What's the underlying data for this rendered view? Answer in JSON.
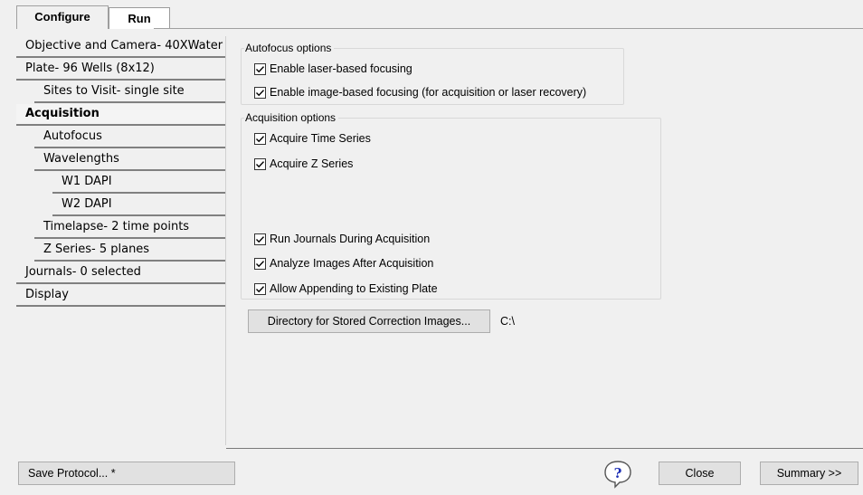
{
  "tabs": [
    {
      "label": "Configure",
      "active": true
    },
    {
      "label": "Run",
      "active": false
    }
  ],
  "nav": {
    "items": [
      {
        "label": "Objective and Camera- 40XWater",
        "level": 0,
        "selected": false
      },
      {
        "label": "Plate- 96 Wells (8x12)",
        "level": 0,
        "selected": false
      },
      {
        "label": "Sites to Visit- single site",
        "level": 1,
        "selected": false
      },
      {
        "label": "Acquisition",
        "level": 0,
        "selected": true
      },
      {
        "label": "Autofocus",
        "level": 1,
        "selected": false
      },
      {
        "label": "Wavelengths",
        "level": 1,
        "selected": false
      },
      {
        "label": "W1 DAPI",
        "level": 2,
        "selected": false
      },
      {
        "label": "W2 DAPI",
        "level": 2,
        "selected": false
      },
      {
        "label": "Timelapse- 2 time points",
        "level": 1,
        "selected": false
      },
      {
        "label": "Z Series- 5 planes",
        "level": 1,
        "selected": false
      },
      {
        "label": "Journals- 0 selected",
        "level": 0,
        "selected": false
      },
      {
        "label": "Display",
        "level": 0,
        "selected": false
      }
    ]
  },
  "autofocus_options": {
    "title": "Autofocus options",
    "options": [
      {
        "label": "Enable laser-based focusing",
        "checked": true
      },
      {
        "label": "Enable image-based focusing (for acquisition or laser recovery)",
        "checked": true
      }
    ]
  },
  "acquisition_options": {
    "title": "Acquisition options",
    "options": [
      {
        "label": "Acquire Time Series",
        "checked": true
      },
      {
        "label": "Acquire Z Series",
        "checked": true
      },
      {
        "label": "Run Journals During Acquisition",
        "checked": true
      },
      {
        "label": "Analyze Images After Acquisition",
        "checked": true
      },
      {
        "label": "Allow Appending to Existing Plate",
        "checked": true
      }
    ]
  },
  "correction_dir": {
    "button_label": "Directory for Stored Correction Images...",
    "path": "C:\\"
  },
  "footer": {
    "save_label": "Save Protocol... *",
    "close_label": "Close",
    "summary_label": "Summary >>"
  },
  "icons": {
    "help": "help-question-bubble-icon",
    "check": "checkmark-icon"
  }
}
